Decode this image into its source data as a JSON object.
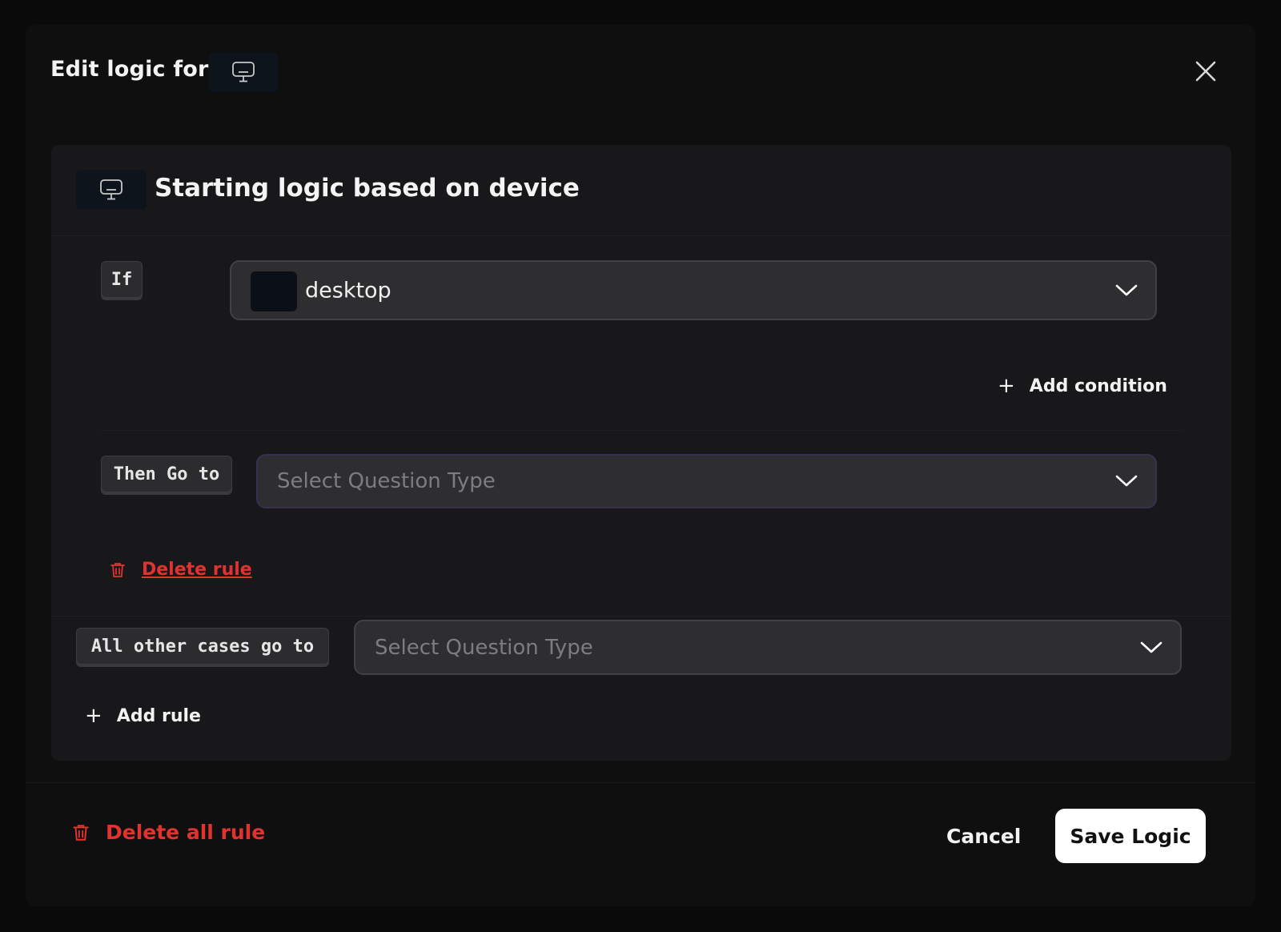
{
  "modal": {
    "title": "Edit logic for",
    "title_icon": "monitor-icon",
    "close_icon": "close-icon"
  },
  "panel": {
    "title": "Starting logic based on device",
    "icon": "monitor-icon"
  },
  "rule": {
    "if_label": "If",
    "condition_value": "desktop",
    "add_condition_label": "Add condition",
    "then_label": "Then Go to",
    "then_placeholder": "Select Question Type",
    "delete_rule_label": "Delete rule"
  },
  "fallback": {
    "label": "All other cases go to",
    "placeholder": "Select Question Type"
  },
  "add_rule_label": "Add rule",
  "footer": {
    "delete_all_label": "Delete all rule",
    "cancel_label": "Cancel",
    "save_label": "Save Logic"
  },
  "colors": {
    "danger": "#e0332f",
    "primary_button": "#ffffff"
  }
}
